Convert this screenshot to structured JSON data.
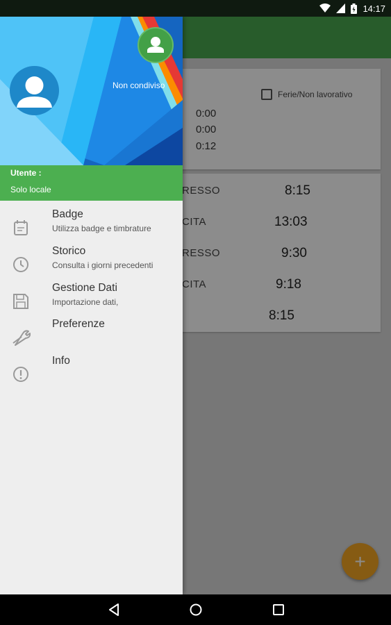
{
  "status_bar": {
    "time": "14:17"
  },
  "drawer": {
    "share_label": "Non condiviso",
    "user_label": "Utente :",
    "user_value": "Solo locale",
    "items": [
      {
        "title": "Badge",
        "subtitle": "Utilizza badge e timbrature",
        "icon": "calendar-icon"
      },
      {
        "title": "Storico",
        "subtitle": "Consulta i giorni precedenti",
        "icon": "clock-icon"
      },
      {
        "title": "Gestione Dati",
        "subtitle": "Importazione dati,",
        "icon": "floppy-disk-icon"
      },
      {
        "title": "Preferenze",
        "subtitle": "",
        "icon": "wrench-icon"
      },
      {
        "title": "Info",
        "subtitle": "",
        "icon": "info-icon"
      }
    ]
  },
  "main": {
    "holiday_label": "Ferie/Non lavorativo",
    "totals": [
      "0:00",
      "0:00",
      "0:12"
    ],
    "rows": [
      {
        "label": "RESSO",
        "value": "8:15"
      },
      {
        "label": "CITA",
        "value": "13:03"
      },
      {
        "label": "RESSO",
        "value": "9:30"
      },
      {
        "label": "CITA",
        "value": "9:18"
      },
      {
        "label": "",
        "value": "8:15"
      }
    ]
  },
  "fab": {
    "label": "+"
  },
  "colors": {
    "toolbar": "#4aa84f",
    "drawer_band": "#4caf50",
    "fab": "#f5a623"
  }
}
